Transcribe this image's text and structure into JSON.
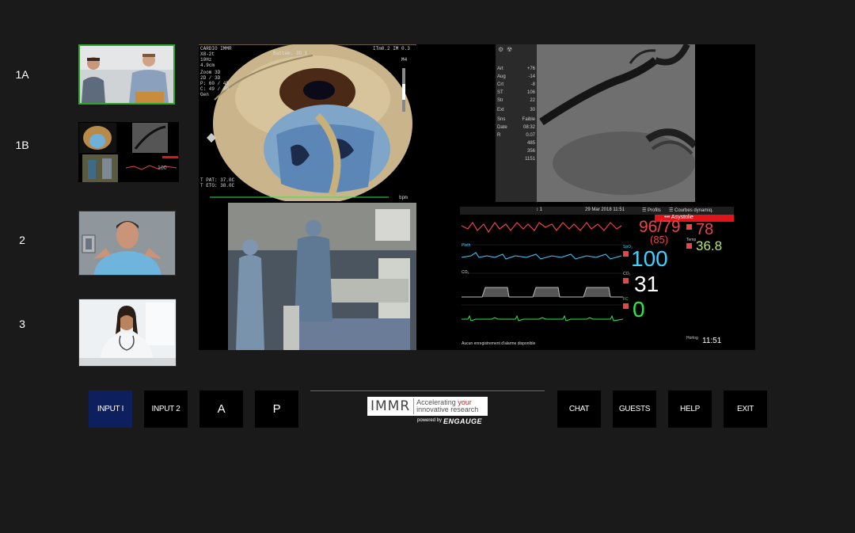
{
  "rows": [
    {
      "label": "1A"
    },
    {
      "label": "1B"
    },
    {
      "label": "2"
    },
    {
      "label": "3"
    }
  ],
  "echo": {
    "header_left": "CARDIO IMMR",
    "probe": "X8-2t",
    "freq": "10Hz",
    "depth": "4.9cm",
    "mode_title": "Battem. 3D 1",
    "header_right": "ITm0.2  IM 0.3",
    "zoom_label": "Zoom 3D",
    "dims": "2D / 3D",
    "p_line": "P: 60 / 45",
    "c_line": "C: 49 / 30",
    "gen": "Gen",
    "tpat": "T PAT: 37.0C",
    "teto": "T ETO: 38.0C",
    "bpm": "bpm",
    "m4": "M4"
  },
  "hemo_sidebar": [
    {
      "label": "Art",
      "value": "+76"
    },
    {
      "label": "Aug",
      "value": "-14"
    },
    {
      "label": "Crt",
      "value": "-8"
    },
    {
      "label": "ST",
      "value": "106"
    },
    {
      "label": "Str",
      "value": "22"
    },
    {
      "label": "Ext",
      "value": "30"
    },
    {
      "label": "Sns",
      "value": "Faible"
    },
    {
      "label": "Date",
      "value": "08:32"
    },
    {
      "label": "R",
      "value": "0.07"
    },
    {
      "label": "",
      "value": "485"
    },
    {
      "label": "",
      "value": "356"
    },
    {
      "label": "",
      "value": "1151"
    }
  ],
  "monitor": {
    "bed": "1",
    "datetime": "29 Mar 2018  11:51",
    "profile": "Profils",
    "courbes": "Courbes dynamiq.",
    "alarm": "Asystolie",
    "nibp": "96/79",
    "nibp_mean": "(85)",
    "hr": "78",
    "temp_label": "Temp",
    "temp": "36.8",
    "spo2_label": "SpO₂",
    "spo2": "100",
    "co2_label": "CO₂",
    "etco2": "31",
    "fc_label": "FC",
    "fc": "0",
    "pleth_label": "Pleth",
    "co2_wave_label": "CO₂",
    "footer": "Aucun enregistrement d'alarme disponible",
    "clock_label": "Horlog",
    "clock": "11:51"
  },
  "buttons": {
    "input1": "INPUT I",
    "input2": "INPUT 2",
    "a": "A",
    "p": "P",
    "chat": "CHAT",
    "guests": "GUESTS",
    "help": "HELP",
    "exit": "EXIT"
  },
  "logo": {
    "immr": "IMMR",
    "tag_line1_a": "Accelerating ",
    "tag_line1_b": "your",
    "tag_line2": "innovative research",
    "powered": "powered by",
    "brand": "ENGAUGE"
  },
  "colors": {
    "active_border": "#2fa52c",
    "selected_button": "#0d1f5c",
    "alarm_red": "#e0151b",
    "spo2_cyan": "#3fd0ff",
    "ecg_green": "#2ee84a",
    "art_red": "#e84545",
    "temp_yellowgreen": "#b7e66b"
  }
}
